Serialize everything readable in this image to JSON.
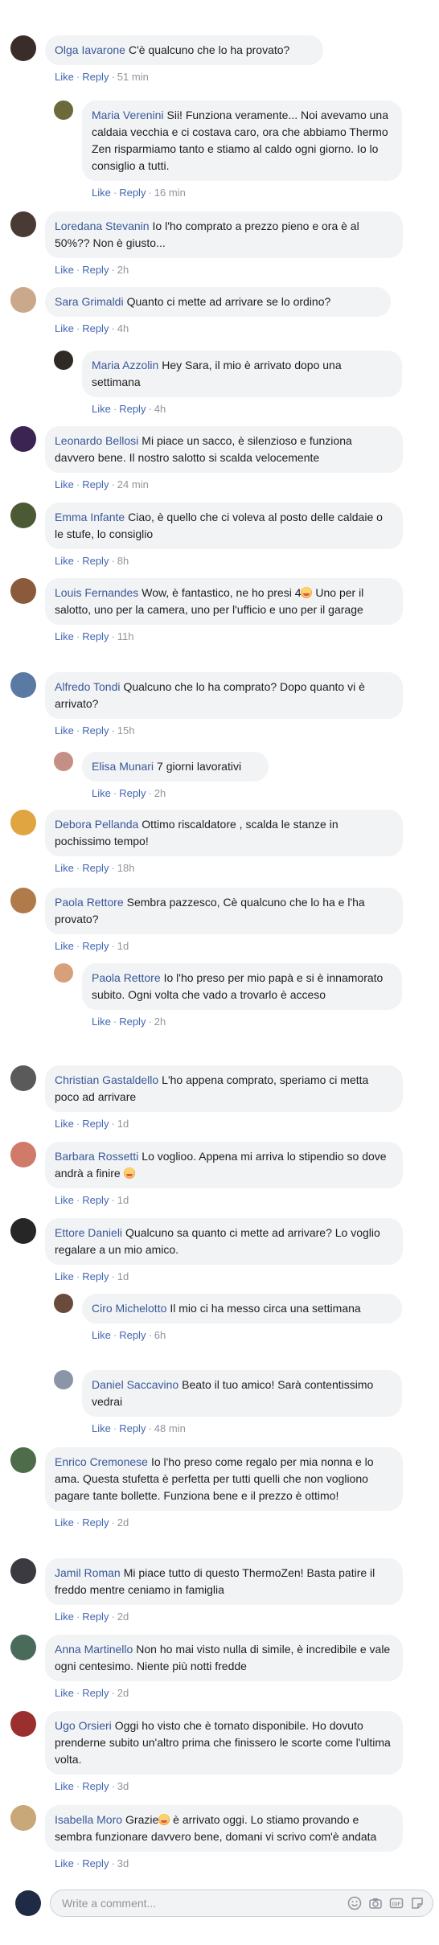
{
  "action_labels": {
    "like": "Like",
    "reply": "Reply"
  },
  "comments": [
    {
      "name": "Olga Iavarone",
      "text": "C'è qualcuno che lo ha provato?",
      "time": "51 min",
      "avatar_color": "#3a2d29"
    },
    {
      "name": "Maria Verenini",
      "text": "Sii! Funziona veramente... Noi avevamo una caldaia vecchia e ci costava caro, ora che abbiamo Thermo Zen risparmiamo tanto e stiamo al caldo ogni giorno. Io lo consiglio a tutti.",
      "time": "16 min",
      "avatar_color": "#6b6a3b"
    },
    {
      "name": "Loredana Stevanin",
      "text": "Io l'ho comprato a prezzo pieno e ora è al 50%?? Non è giusto...",
      "time": "2h",
      "avatar_color": "#4a3a36"
    },
    {
      "name": "Sara Grimaldi",
      "text": "Quanto ci mette ad arrivare se lo ordino?",
      "time": "4h",
      "avatar_color": "#c9a98a"
    },
    {
      "name": "Maria Azzolin",
      "text": "Hey Sara, il mio è arrivato dopo una settimana",
      "time": "4h",
      "avatar_color": "#2f2a26"
    },
    {
      "name": "Leonardo Bellosi",
      "text": "Mi piace un sacco, è silenzioso e funziona davvero bene. Il nostro salotto si scalda velocemente",
      "time": "24 min",
      "avatar_color": "#3b2452"
    },
    {
      "name": "Emma Infante",
      "text": "Ciao, è quello che ci voleva al posto delle caldaie o le stufe, lo consiglio",
      "time": "8h",
      "avatar_color": "#4b5a34"
    },
    {
      "name": "Louis Fernandes",
      "text": "Wow, è fantastico, ne ho presi 4",
      "text2": " Uno per il salotto, uno per la camera, uno per l'ufficio e uno per il garage",
      "time": "11h",
      "avatar_color": "#8a5a3a"
    },
    {
      "name": "Alfredo Tondi",
      "text": "Qualcuno che lo ha comprato? Dopo quanto vi è arrivato?",
      "time": "15h",
      "avatar_color": "#5b7aa3"
    },
    {
      "name": "Elisa Munari",
      "text": "7 giorni lavorativi",
      "time": "2h",
      "avatar_color": "#c58f86"
    },
    {
      "name": "Debora Pellanda",
      "text": "Ottimo riscaldatore , scalda le stanze in pochissimo tempo!",
      "time": "18h",
      "avatar_color": "#e0a441"
    },
    {
      "name": "Paola Rettore",
      "text": "Sembra pazzesco, Cè qualcuno che lo ha e l'ha provato?",
      "time": "1d",
      "avatar_color": "#b07a4a"
    },
    {
      "name": "Paola Rettore",
      "text": "Io l'ho preso per mio papà e si è innamorato subito. Ogni volta che vado a trovarlo è acceso",
      "time": "2h",
      "avatar_color": "#d8a07a"
    },
    {
      "name": "Christian Gastaldello",
      "text": "L'ho appena comprato, speriamo ci metta poco ad arrivare",
      "time": "1d",
      "avatar_color": "#5a5a5a"
    },
    {
      "name": "Barbara Rossetti",
      "text": "Lo voglioo. Appena mi arriva lo stipendio so dove andrà a finire",
      "time": "1d",
      "avatar_color": "#d07a6a"
    },
    {
      "name": "Ettore Danieli",
      "text": "Qualcuno sa quanto ci mette ad arrivare? Lo voglio regalare a un mio amico.",
      "time": "1d",
      "avatar_color": "#262626"
    },
    {
      "name": "Ciro Michelotto",
      "text": "Il mio ci ha messo circa una settimana",
      "time": "6h",
      "avatar_color": "#6a4a3a"
    },
    {
      "name": "Daniel Saccavino",
      "text": "Beato il tuo amico! Sarà contentissimo vedrai",
      "time": "48 min",
      "avatar_color": "#8a96a8"
    },
    {
      "name": "Enrico Cremonese",
      "text": "Io l'ho preso come regalo per mia nonna e lo ama. Questa stufetta è perfetta per tutti quelli che non vogliono pagare tante bollette. Funziona bene e il prezzo è ottimo!",
      "time": "2d",
      "avatar_color": "#4e6b4a"
    },
    {
      "name": "Jamil Roman",
      "text": "Mi piace tutto di questo ThermoZen! Basta patire il freddo mentre ceniamo in famiglia",
      "time": "2d",
      "avatar_color": "#3a3a40"
    },
    {
      "name": "Anna Martinello",
      "text": "Non ho mai visto nulla di simile, è incredibile e vale ogni centesimo. Niente più notti fredde",
      "time": "2d",
      "avatar_color": "#4a6a5a"
    },
    {
      "name": "Ugo Orsieri",
      "text": "Oggi ho visto che è tornato disponibile. Ho dovuto prenderne subito un'altro prima che finissero le scorte come l'ultima volta.",
      "time": "3d",
      "avatar_color": "#9a2f2f"
    },
    {
      "name": "Isabella Moro",
      "text": "Grazie",
      "text2": " è arrivato oggi. Lo stiamo provando e sembra funzionare davvero bene, domani vi scrivo com'è andata",
      "time": "3d",
      "avatar_color": "#c8a878"
    }
  ],
  "composer": {
    "placeholder": "Write a comment...",
    "icons": [
      "emoji-icon",
      "camera-icon",
      "gif-icon",
      "sticker-icon"
    ],
    "avatar_color": "#1f2a44"
  }
}
